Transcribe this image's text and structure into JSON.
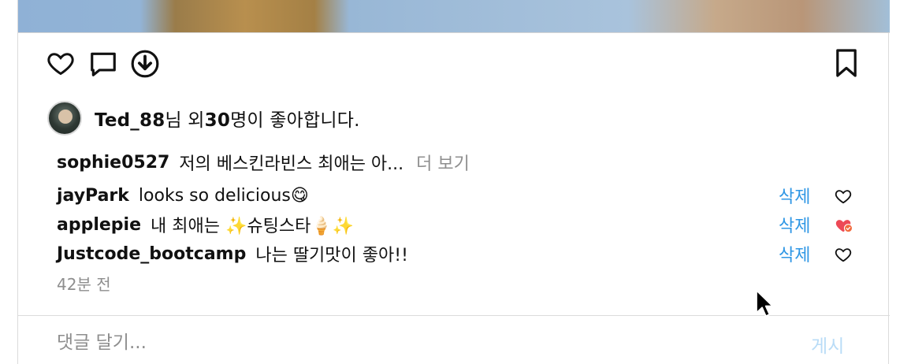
{
  "post": {
    "likes": {
      "user": "Ted_88",
      "suffix_pre": "님 외",
      "count": "30",
      "suffix_post": "명이 좋아합니다."
    },
    "caption": {
      "user": "sophie0527",
      "text": "저의 베스킨라빈스 최애는 아...",
      "more": "더 보기"
    },
    "comments": [
      {
        "user": "jayPark",
        "text": "looks so delicious😋",
        "delete": "삭제",
        "liked": false
      },
      {
        "user": "applepie",
        "text": "내 최애는 ✨슈팅스타🍦✨",
        "delete": "삭제",
        "liked": true
      },
      {
        "user": "Justcode_bootcamp",
        "text": "나는 딸기맛이 좋아!!",
        "delete": "삭제",
        "liked": false
      }
    ],
    "time": "42분 전"
  },
  "composer": {
    "placeholder": "댓글 달기...",
    "post_label": "게시"
  },
  "icons": {
    "like": "heart-icon",
    "comment": "comment-icon",
    "download": "download-icon",
    "bookmark": "bookmark-icon",
    "liked_heart_color": "#ed4956",
    "delete_color": "#2f97e5"
  }
}
